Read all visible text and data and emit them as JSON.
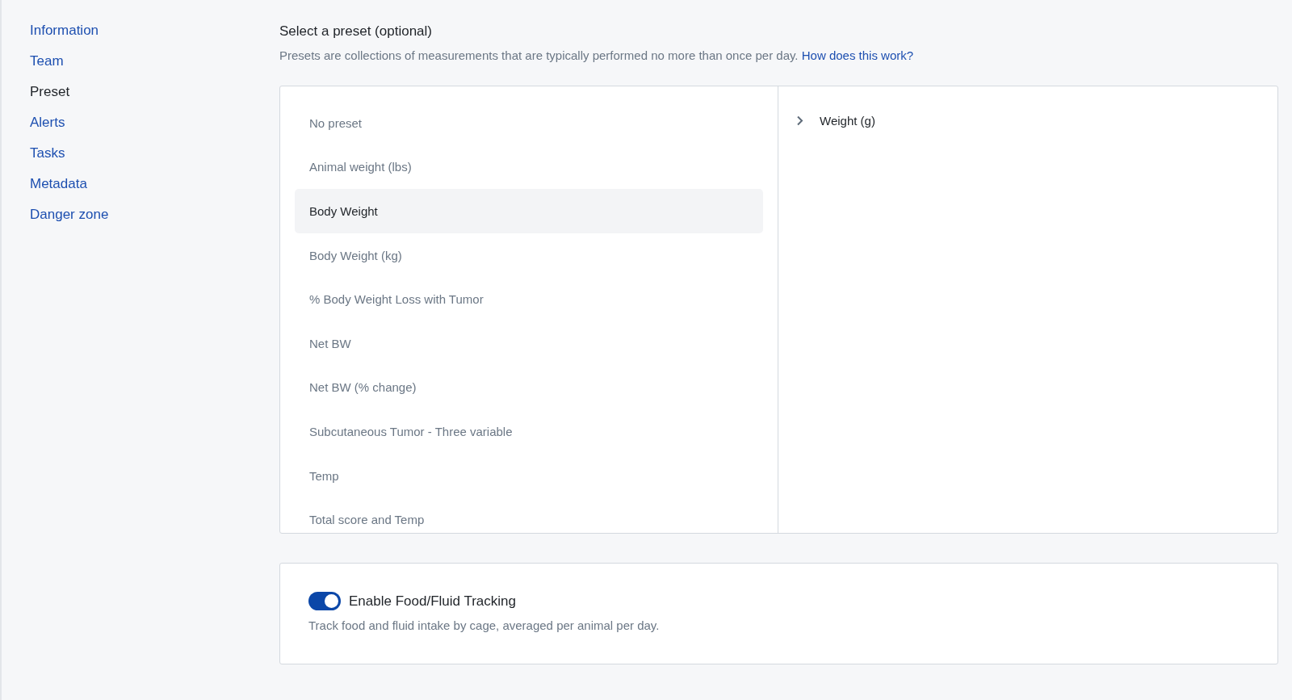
{
  "sidebar": {
    "items": [
      {
        "label": "Information",
        "selected": false
      },
      {
        "label": "Team",
        "selected": false
      },
      {
        "label": "Preset",
        "selected": true
      },
      {
        "label": "Alerts",
        "selected": false
      },
      {
        "label": "Tasks",
        "selected": false
      },
      {
        "label": "Metadata",
        "selected": false
      },
      {
        "label": "Danger zone",
        "selected": false
      }
    ]
  },
  "preset": {
    "title": "Select a preset (optional)",
    "description": "Presets are collections of measurements that are typically performed no more than once per day.",
    "help_link": "How does this work?",
    "options": [
      {
        "label": "No preset",
        "selected": false
      },
      {
        "label": "Animal weight (lbs)",
        "selected": false
      },
      {
        "label": "Body Weight",
        "selected": true
      },
      {
        "label": "Body Weight (kg)",
        "selected": false
      },
      {
        "label": "% Body Weight Loss with Tumor",
        "selected": false
      },
      {
        "label": "Net BW",
        "selected": false
      },
      {
        "label": "Net BW (% change)",
        "selected": false
      },
      {
        "label": "Subcutaneous Tumor - Three variable",
        "selected": false
      },
      {
        "label": "Temp",
        "selected": false
      },
      {
        "label": "Total score and Temp",
        "selected": false
      }
    ],
    "measurements": [
      {
        "label": "Weight (g)",
        "expanded": false
      }
    ]
  },
  "tracking": {
    "label": "Enable Food/Fluid Tracking",
    "on": true,
    "description": "Track food and fluid intake by cage, averaged per animal per day."
  }
}
